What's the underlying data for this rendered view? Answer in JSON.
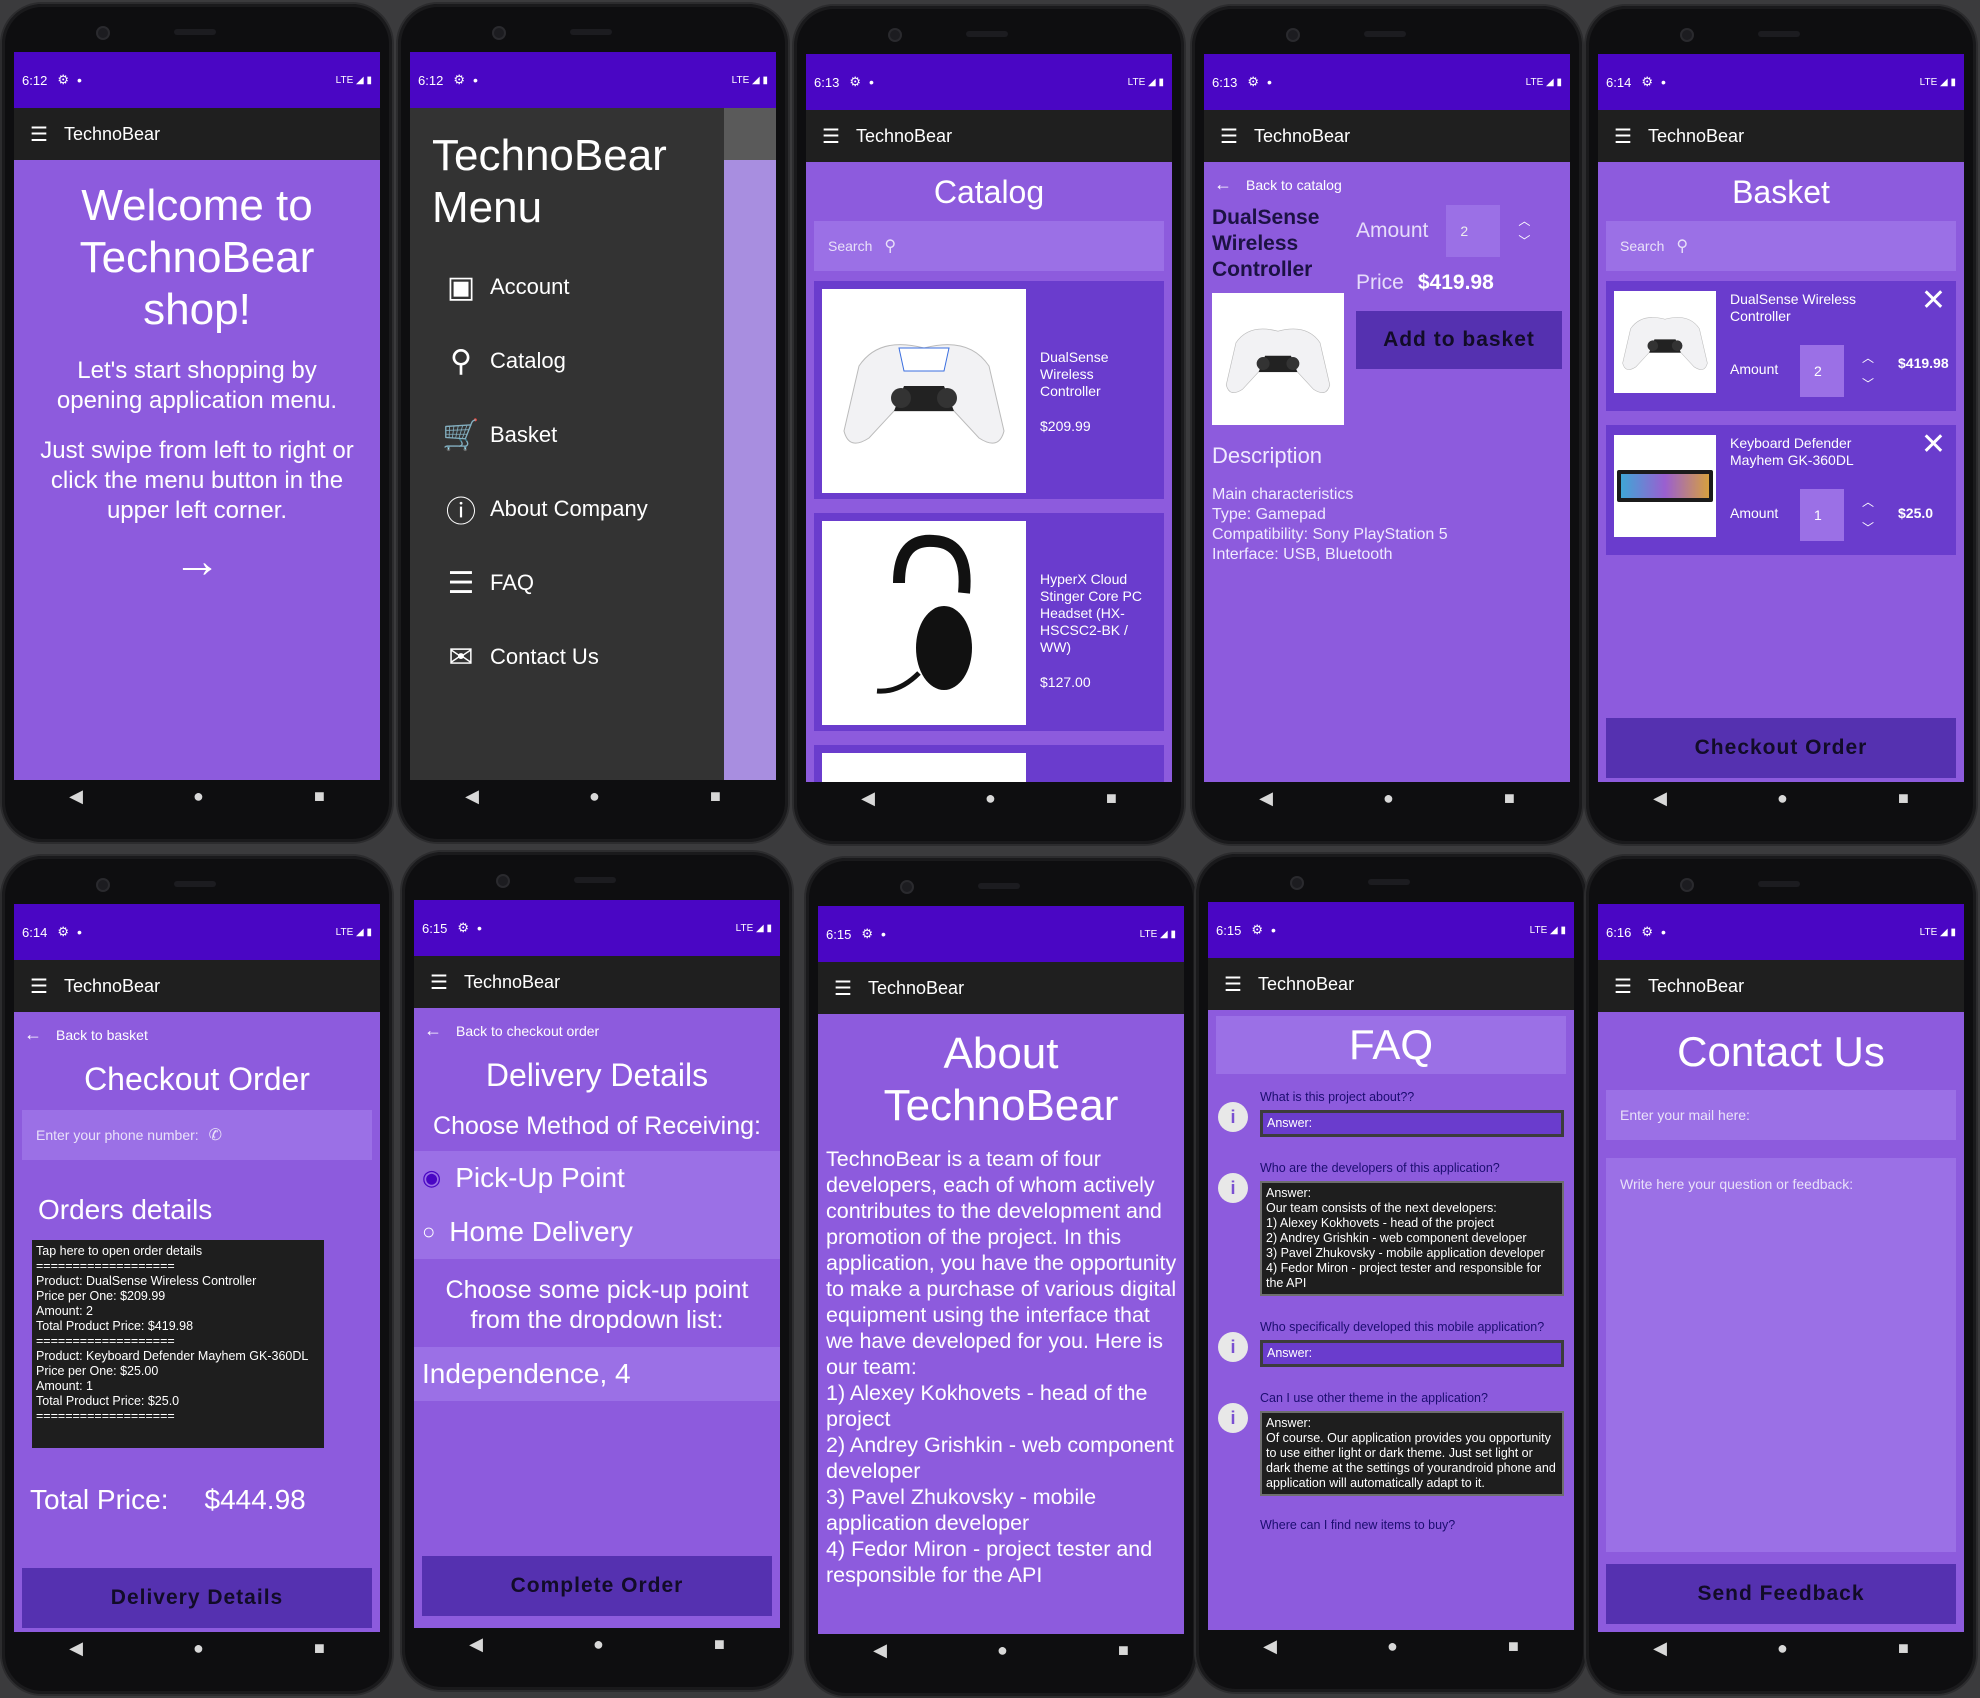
{
  "app_title": "TechnoBear",
  "screens": {
    "welcome": {
      "time": "6:12",
      "title": "Welcome to TechnoBear shop!",
      "line1": "Let's start shopping by opening application menu.",
      "line2": "Just swipe from left to right or click the menu button in the upper left corner."
    },
    "menu": {
      "time": "6:12",
      "title": "TechnoBear Menu",
      "items": [
        {
          "label": "Account"
        },
        {
          "label": "Catalog"
        },
        {
          "label": "Basket"
        },
        {
          "label": "About Company"
        },
        {
          "label": "FAQ"
        },
        {
          "label": "Contact Us"
        }
      ]
    },
    "catalog": {
      "time": "6:13",
      "title": "Catalog",
      "search_placeholder": "Search",
      "products": [
        {
          "name": "DualSense Wireless Controller",
          "price": "$209.99"
        },
        {
          "name": "HyperX Cloud Stinger Core PC Headset (HX-HSCSC2-BK / WW)",
          "price": "$127.00"
        }
      ]
    },
    "product": {
      "time": "6:13",
      "back": "Back to catalog",
      "name": "DualSense Wireless Controller",
      "amount_label": "Amount",
      "amount": "2",
      "price_label": "Price",
      "price": "$419.98",
      "add_button": "Add to basket",
      "desc_title": "Description",
      "desc": [
        "Main characteristics",
        "Type: Gamepad",
        "Compatibility: Sony PlayStation 5",
        "Interface: USB, Bluetooth"
      ]
    },
    "basket": {
      "time": "6:14",
      "title": "Basket",
      "search_placeholder": "Search",
      "items": [
        {
          "name": "DualSense Wireless Controller",
          "amount_label": "Amount",
          "amount": "2",
          "price": "$419.98"
        },
        {
          "name": "Keyboard Defender Mayhem GK-360DL",
          "amount_label": "Amount",
          "amount": "1",
          "price": "$25.0"
        }
      ],
      "checkout_button": "Checkout Order"
    },
    "checkout": {
      "time": "6:14",
      "back": "Back to basket",
      "title": "Checkout Order",
      "phone_placeholder": "Enter your phone number:",
      "orders_title": "Orders details",
      "details": [
        "Tap here to open order details",
        "===================",
        "Product: DualSense Wireless Controller",
        "Price per One: $209.99",
        "Amount: 2",
        "Total Product Price: $419.98",
        "===================",
        "Product: Keyboard Defender Mayhem GK-360DL",
        "Price per One: $25.00",
        "Amount: 1",
        "Total Product Price: $25.0",
        "==================="
      ],
      "total_label": "Total Price:",
      "total": "$444.98",
      "button": "Delivery Details"
    },
    "delivery": {
      "time": "6:15",
      "back": "Back to checkout order",
      "title": "Delivery Details",
      "choose": "Choose Method of Receiving:",
      "options": [
        {
          "label": "Pick-Up Point"
        },
        {
          "label": "Home Delivery"
        }
      ],
      "pick_text": "Choose some pick-up point from the dropdown list:",
      "selected_point": "Independence, 4",
      "button": "Complete Order"
    },
    "about": {
      "time": "6:15",
      "title": "About TechnoBear",
      "text": "TechnoBear is a team of four developers, each of whom actively contributes to the development and promotion of the project. In this application, you have the opportunity to make a purchase of various digital equipment using the interface that we have developed for you. Here is our team:",
      "team": [
        "1) Alexey Kokhovets - head of the project",
        "2) Andrey Grishkin - web component developer",
        "3) Pavel Zhukovsky - mobile application developer",
        "4) Fedor Miron - project tester and responsible for the API"
      ]
    },
    "faq": {
      "time": "6:15",
      "title": "FAQ",
      "items": [
        {
          "q": "What is this project about??",
          "a": [
            "Answer:"
          ]
        },
        {
          "q": "Who are the developers of this application?",
          "a": [
            "Answer:",
            "Our team consists of the next developers:",
            "1) Alexey Kokhovets - head of the project",
            "2) Andrey Grishkin - web component developer",
            "3) Pavel Zhukovsky - mobile application developer",
            "4) Fedor Miron - project tester and responsible for the API"
          ]
        },
        {
          "q": "Who specifically developed this mobile application?",
          "a": [
            "Answer:"
          ]
        },
        {
          "q": "Can I use other theme in the application?",
          "a": [
            "Answer:",
            "Of course. Our application provides you opportunity to use either light or dark theme. Just set light or dark theme at the settings of yourandroid phone and application will automatically adapt to it."
          ]
        },
        {
          "q": "Where can I find new items to buy?",
          "a": []
        }
      ]
    },
    "contact": {
      "time": "6:16",
      "title": "Contact Us",
      "mail_placeholder": "Enter your mail here:",
      "feedback_placeholder": "Write here your question or feedback:",
      "button": "Send Feedback"
    }
  },
  "status_lte": "LTE",
  "colors": {
    "status_bar": "#4a06c4",
    "toolbar": "#1f1f1f",
    "screen_bg": "#8d5bdd",
    "button": "#5531b0",
    "card": "#6a3ccd"
  }
}
